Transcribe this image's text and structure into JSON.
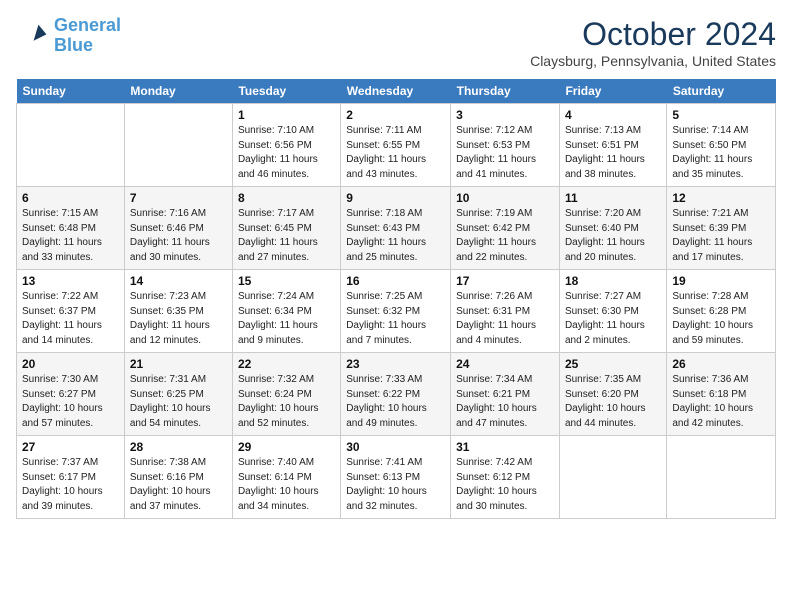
{
  "header": {
    "logo_line1": "General",
    "logo_line2": "Blue",
    "month": "October 2024",
    "location": "Claysburg, Pennsylvania, United States"
  },
  "days_of_week": [
    "Sunday",
    "Monday",
    "Tuesday",
    "Wednesday",
    "Thursday",
    "Friday",
    "Saturday"
  ],
  "weeks": [
    [
      {
        "day": "",
        "sunrise": "",
        "sunset": "",
        "daylight": ""
      },
      {
        "day": "",
        "sunrise": "",
        "sunset": "",
        "daylight": ""
      },
      {
        "day": "1",
        "sunrise": "Sunrise: 7:10 AM",
        "sunset": "Sunset: 6:56 PM",
        "daylight": "Daylight: 11 hours and 46 minutes."
      },
      {
        "day": "2",
        "sunrise": "Sunrise: 7:11 AM",
        "sunset": "Sunset: 6:55 PM",
        "daylight": "Daylight: 11 hours and 43 minutes."
      },
      {
        "day": "3",
        "sunrise": "Sunrise: 7:12 AM",
        "sunset": "Sunset: 6:53 PM",
        "daylight": "Daylight: 11 hours and 41 minutes."
      },
      {
        "day": "4",
        "sunrise": "Sunrise: 7:13 AM",
        "sunset": "Sunset: 6:51 PM",
        "daylight": "Daylight: 11 hours and 38 minutes."
      },
      {
        "day": "5",
        "sunrise": "Sunrise: 7:14 AM",
        "sunset": "Sunset: 6:50 PM",
        "daylight": "Daylight: 11 hours and 35 minutes."
      }
    ],
    [
      {
        "day": "6",
        "sunrise": "Sunrise: 7:15 AM",
        "sunset": "Sunset: 6:48 PM",
        "daylight": "Daylight: 11 hours and 33 minutes."
      },
      {
        "day": "7",
        "sunrise": "Sunrise: 7:16 AM",
        "sunset": "Sunset: 6:46 PM",
        "daylight": "Daylight: 11 hours and 30 minutes."
      },
      {
        "day": "8",
        "sunrise": "Sunrise: 7:17 AM",
        "sunset": "Sunset: 6:45 PM",
        "daylight": "Daylight: 11 hours and 27 minutes."
      },
      {
        "day": "9",
        "sunrise": "Sunrise: 7:18 AM",
        "sunset": "Sunset: 6:43 PM",
        "daylight": "Daylight: 11 hours and 25 minutes."
      },
      {
        "day": "10",
        "sunrise": "Sunrise: 7:19 AM",
        "sunset": "Sunset: 6:42 PM",
        "daylight": "Daylight: 11 hours and 22 minutes."
      },
      {
        "day": "11",
        "sunrise": "Sunrise: 7:20 AM",
        "sunset": "Sunset: 6:40 PM",
        "daylight": "Daylight: 11 hours and 20 minutes."
      },
      {
        "day": "12",
        "sunrise": "Sunrise: 7:21 AM",
        "sunset": "Sunset: 6:39 PM",
        "daylight": "Daylight: 11 hours and 17 minutes."
      }
    ],
    [
      {
        "day": "13",
        "sunrise": "Sunrise: 7:22 AM",
        "sunset": "Sunset: 6:37 PM",
        "daylight": "Daylight: 11 hours and 14 minutes."
      },
      {
        "day": "14",
        "sunrise": "Sunrise: 7:23 AM",
        "sunset": "Sunset: 6:35 PM",
        "daylight": "Daylight: 11 hours and 12 minutes."
      },
      {
        "day": "15",
        "sunrise": "Sunrise: 7:24 AM",
        "sunset": "Sunset: 6:34 PM",
        "daylight": "Daylight: 11 hours and 9 minutes."
      },
      {
        "day": "16",
        "sunrise": "Sunrise: 7:25 AM",
        "sunset": "Sunset: 6:32 PM",
        "daylight": "Daylight: 11 hours and 7 minutes."
      },
      {
        "day": "17",
        "sunrise": "Sunrise: 7:26 AM",
        "sunset": "Sunset: 6:31 PM",
        "daylight": "Daylight: 11 hours and 4 minutes."
      },
      {
        "day": "18",
        "sunrise": "Sunrise: 7:27 AM",
        "sunset": "Sunset: 6:30 PM",
        "daylight": "Daylight: 11 hours and 2 minutes."
      },
      {
        "day": "19",
        "sunrise": "Sunrise: 7:28 AM",
        "sunset": "Sunset: 6:28 PM",
        "daylight": "Daylight: 10 hours and 59 minutes."
      }
    ],
    [
      {
        "day": "20",
        "sunrise": "Sunrise: 7:30 AM",
        "sunset": "Sunset: 6:27 PM",
        "daylight": "Daylight: 10 hours and 57 minutes."
      },
      {
        "day": "21",
        "sunrise": "Sunrise: 7:31 AM",
        "sunset": "Sunset: 6:25 PM",
        "daylight": "Daylight: 10 hours and 54 minutes."
      },
      {
        "day": "22",
        "sunrise": "Sunrise: 7:32 AM",
        "sunset": "Sunset: 6:24 PM",
        "daylight": "Daylight: 10 hours and 52 minutes."
      },
      {
        "day": "23",
        "sunrise": "Sunrise: 7:33 AM",
        "sunset": "Sunset: 6:22 PM",
        "daylight": "Daylight: 10 hours and 49 minutes."
      },
      {
        "day": "24",
        "sunrise": "Sunrise: 7:34 AM",
        "sunset": "Sunset: 6:21 PM",
        "daylight": "Daylight: 10 hours and 47 minutes."
      },
      {
        "day": "25",
        "sunrise": "Sunrise: 7:35 AM",
        "sunset": "Sunset: 6:20 PM",
        "daylight": "Daylight: 10 hours and 44 minutes."
      },
      {
        "day": "26",
        "sunrise": "Sunrise: 7:36 AM",
        "sunset": "Sunset: 6:18 PM",
        "daylight": "Daylight: 10 hours and 42 minutes."
      }
    ],
    [
      {
        "day": "27",
        "sunrise": "Sunrise: 7:37 AM",
        "sunset": "Sunset: 6:17 PM",
        "daylight": "Daylight: 10 hours and 39 minutes."
      },
      {
        "day": "28",
        "sunrise": "Sunrise: 7:38 AM",
        "sunset": "Sunset: 6:16 PM",
        "daylight": "Daylight: 10 hours and 37 minutes."
      },
      {
        "day": "29",
        "sunrise": "Sunrise: 7:40 AM",
        "sunset": "Sunset: 6:14 PM",
        "daylight": "Daylight: 10 hours and 34 minutes."
      },
      {
        "day": "30",
        "sunrise": "Sunrise: 7:41 AM",
        "sunset": "Sunset: 6:13 PM",
        "daylight": "Daylight: 10 hours and 32 minutes."
      },
      {
        "day": "31",
        "sunrise": "Sunrise: 7:42 AM",
        "sunset": "Sunset: 6:12 PM",
        "daylight": "Daylight: 10 hours and 30 minutes."
      },
      {
        "day": "",
        "sunrise": "",
        "sunset": "",
        "daylight": ""
      },
      {
        "day": "",
        "sunrise": "",
        "sunset": "",
        "daylight": ""
      }
    ]
  ]
}
